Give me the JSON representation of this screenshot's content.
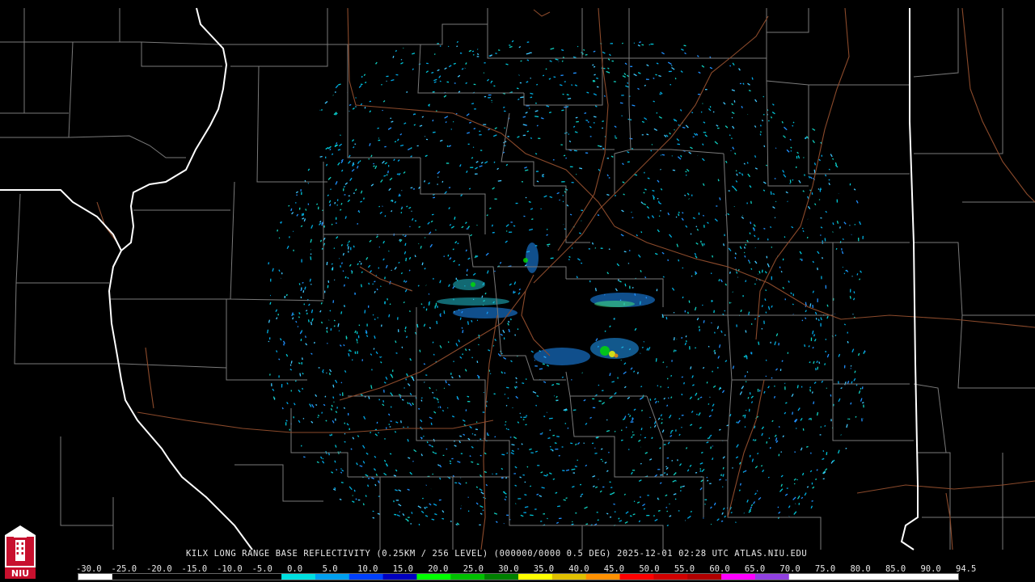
{
  "title": "KILX LONG RANGE BASE REFLECTIVITY (0.25KM / 256 LEVEL) (000000/0000 0.5 DEG) 2025-12-01 02:28 UTC  ATLAS.NIU.EDU",
  "logo_text": "NIU",
  "scale": {
    "labels": [
      "-30.0",
      "-25.0",
      "-20.0",
      "-15.0",
      "-10.0",
      "-5.0",
      "0.0",
      "5.0",
      "10.0",
      "15.0",
      "20.0",
      "25.0",
      "30.0",
      "35.0",
      "40.0",
      "45.0",
      "50.0",
      "55.0",
      "60.0",
      "65.0",
      "70.0",
      "75.0",
      "80.0",
      "85.0",
      "90.0",
      "94.5"
    ],
    "colors": [
      "#ffffff",
      "#000000",
      "#000000",
      "#000000",
      "#000000",
      "#000000",
      "#00e0e0",
      "#00a0f0",
      "#0040ff",
      "#0000c0",
      "#00ff00",
      "#00c000",
      "#008000",
      "#ffff00",
      "#e0c000",
      "#ff9000",
      "#ff0000",
      "#d00000",
      "#b00000",
      "#ff00ff",
      "#9040e0",
      "#ffffff",
      "#ffffff",
      "#ffffff",
      "#ffffff",
      "#ffffff"
    ]
  },
  "map_colors": {
    "background": "#000000",
    "county_lines": "#7a7a7a",
    "state_lines": "#ffffff",
    "rivers_roads": "#8b4a2b"
  }
}
